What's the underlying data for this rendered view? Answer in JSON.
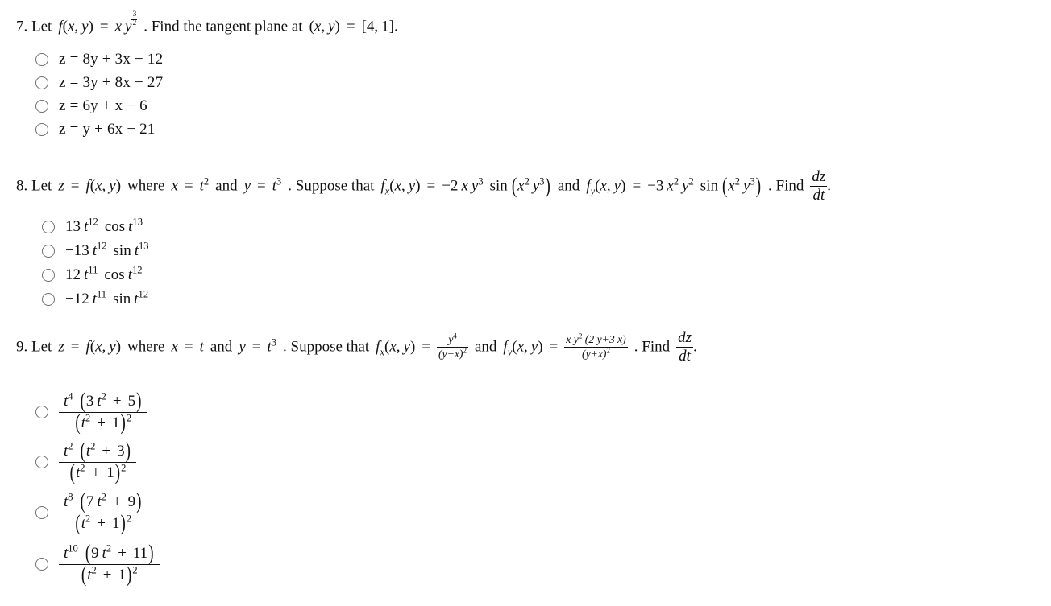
{
  "document": {
    "type": "multiple-choice-math-quiz",
    "background_color": "#ffffff",
    "text_color": "#111111"
  },
  "questions": [
    {
      "number": "7.",
      "stem": {
        "lead": "Let",
        "function_def": "f(x, y) = x y^(3/2)",
        "exponent_numerator": "3",
        "exponent_denominator": "2",
        "instruction": ". Find the tangent plane at",
        "point": "(x, y) = [4, 1]",
        "terminator": "."
      },
      "options": [
        {
          "id": "7a",
          "text": "z = 8y + 3x − 12",
          "selected": false
        },
        {
          "id": "7b",
          "text": "z = 3y + 8x − 27",
          "selected": false
        },
        {
          "id": "7c",
          "text": "z = 6y + x − 6",
          "selected": false
        },
        {
          "id": "7d",
          "text": "z = y + 6x − 21",
          "selected": false
        }
      ]
    },
    {
      "number": "8.",
      "stem": {
        "lead": "Let",
        "z_eq": "z = f(x, y)",
        "where": "where",
        "x_sub": "x = t²",
        "and1": "and",
        "y_sub": "y = t³",
        "suppose": ". Suppose that",
        "fx_label": "f_x(x, y) =",
        "fx_value": "−2 x y³ sin (x² y³)",
        "and2": "and",
        "fy_label": "f_y(x, y) =",
        "fy_value": "−3 x² y² sin (x² y³)",
        "find": ". Find",
        "derivative_num": "dz",
        "derivative_den": "dt",
        "terminator": "."
      },
      "options": [
        {
          "id": "8a",
          "text": "13 t^12 cos t^13",
          "coef": "13",
          "tpow": "12",
          "trig": "cos",
          "argpow": "13",
          "selected": false
        },
        {
          "id": "8b",
          "text": "−13 t^12 sin t^13",
          "coef": "−13",
          "tpow": "12",
          "trig": "sin",
          "argpow": "13",
          "selected": false
        },
        {
          "id": "8c",
          "text": "12 t^11 cos t^12",
          "coef": "12",
          "tpow": "11",
          "trig": "cos",
          "argpow": "12",
          "selected": false
        },
        {
          "id": "8d",
          "text": "−12 t^11 sin t^12",
          "coef": "−12",
          "tpow": "11",
          "trig": "sin",
          "argpow": "12",
          "selected": false
        }
      ]
    },
    {
      "number": "9.",
      "stem": {
        "lead": "Let",
        "z_eq": "z = f(x, y)",
        "where": "where",
        "x_sub": "x = t",
        "and1": "and",
        "y_sub": "y = t³",
        "suppose": ". Suppose that",
        "fx_label": "f_x(x, y) =",
        "fx_num": "y⁴",
        "fx_den": "(y+x)²",
        "and2": "and",
        "fy_label": "f_y(x, y) =",
        "fy_num": "x y² (2 y+3 x)",
        "fy_den": "(y+x)²",
        "find": ". Find",
        "derivative_num": "dz",
        "derivative_den": "dt",
        "terminator": "."
      },
      "options": [
        {
          "id": "9a",
          "num_tpow": "4",
          "num_coef": "3",
          "num_const": "5",
          "den": "(t² + 1)²",
          "selected": false
        },
        {
          "id": "9b",
          "num_tpow": "2",
          "num_coef": "",
          "num_const": "3",
          "den": "(t² + 1)²",
          "selected": false
        },
        {
          "id": "9c",
          "num_tpow": "8",
          "num_coef": "7",
          "num_const": "9",
          "den": "(t² + 1)²",
          "selected": false
        },
        {
          "id": "9d",
          "num_tpow": "10",
          "num_coef": "9",
          "num_const": "11",
          "den": "(t² + 1)²",
          "selected": false
        }
      ]
    }
  ],
  "glyphs": {
    "minus": "−",
    "equals": "=",
    "plus": "+",
    "radio_unselected": "○"
  }
}
